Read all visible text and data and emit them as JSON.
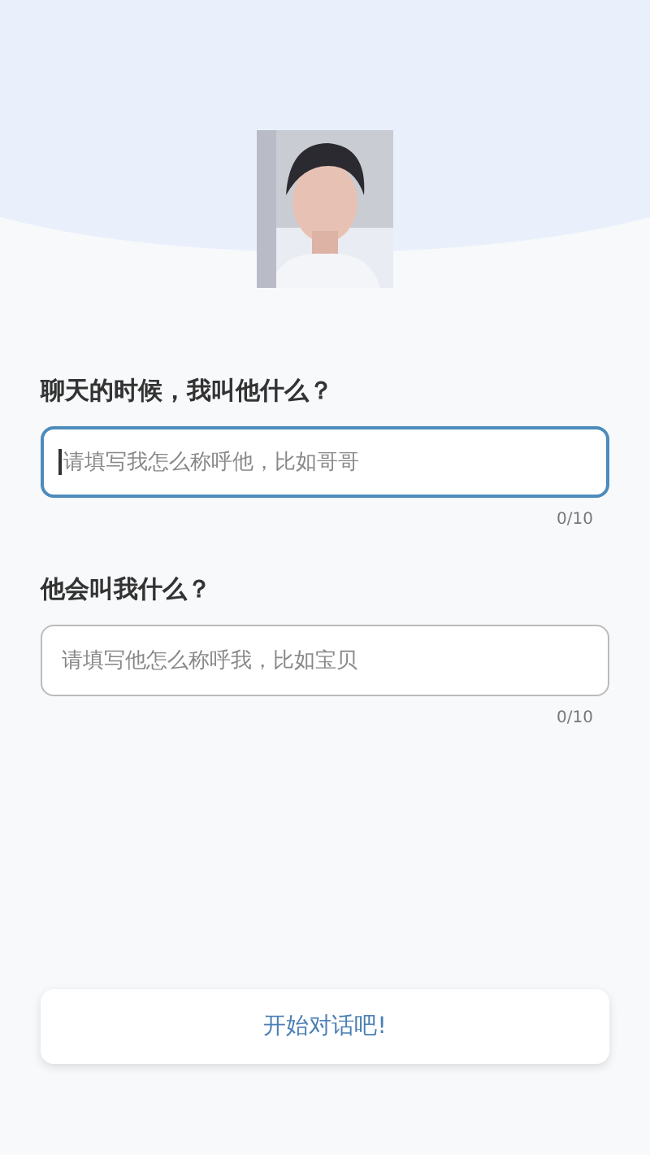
{
  "questions": [
    {
      "label": "聊天的时候，我叫他什么？",
      "field": {
        "placeholder": "请填写我怎么称呼他，比如哥哥",
        "focused": true
      },
      "count": "0/10"
    },
    {
      "label": "他会叫我什么？",
      "field": {
        "placeholder": "请填写他怎么称呼我，比如宝贝",
        "focused": false
      },
      "count": "0/10"
    }
  ],
  "start_button": "开始对话吧!"
}
